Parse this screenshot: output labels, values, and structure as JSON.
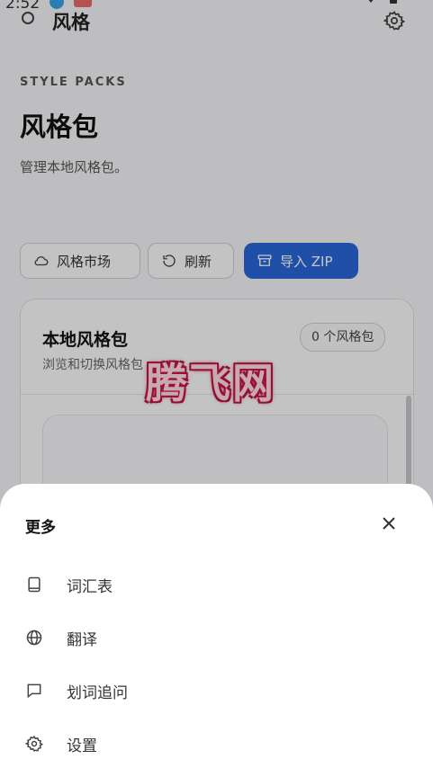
{
  "status_bar": {
    "time": "2:52"
  },
  "app_bar": {
    "title": "风格"
  },
  "header": {
    "eyebrow": "STYLE PACKS",
    "title": "风格包",
    "subtitle": "管理本地风格包。"
  },
  "actions": {
    "market_label": "风格市场",
    "refresh_label": "刷新",
    "import_label": "导入 ZIP"
  },
  "local_card": {
    "title": "本地风格包",
    "description": "浏览和切换风格包",
    "count_badge": "0 个风格包"
  },
  "watermark": "腾飞网",
  "sheet": {
    "title": "更多",
    "items": [
      {
        "label": "词汇表",
        "icon": "book-icon"
      },
      {
        "label": "翻译",
        "icon": "globe-icon"
      },
      {
        "label": "划词追问",
        "icon": "chat-bubble-icon"
      },
      {
        "label": "设置",
        "icon": "gear-icon"
      }
    ]
  },
  "colors": {
    "accent": "#2a66d6",
    "watermark": "#d01a4a"
  }
}
